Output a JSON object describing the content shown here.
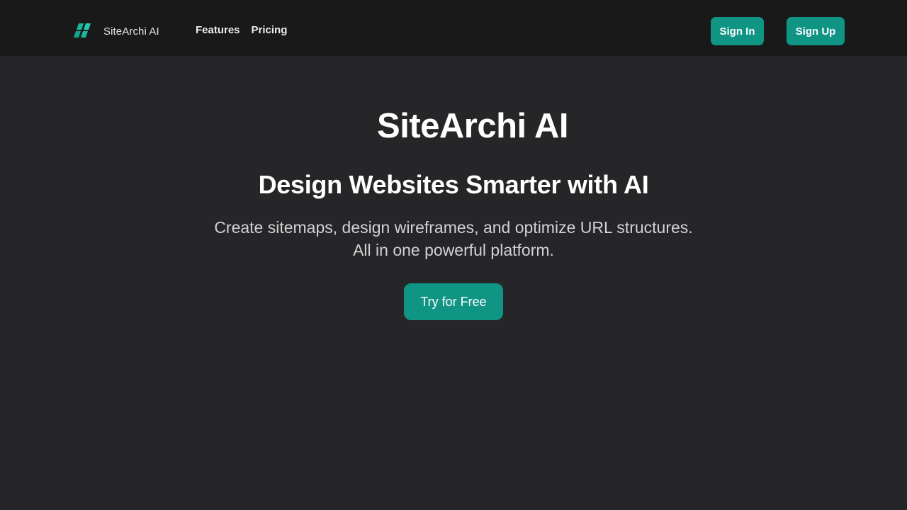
{
  "header": {
    "brand": {
      "name": "SiteArchi AI",
      "icon": "parallelogram-grid-logo-icon",
      "icon_color": "#1fb89f"
    },
    "nav": [
      {
        "label": "Features"
      },
      {
        "label": "Pricing"
      }
    ],
    "signin_label": "Sign In",
    "signup_label": "Sign Up"
  },
  "hero": {
    "title": "SiteArchi AI",
    "subtitle": "Design Websites Smarter with AI",
    "description_line1": "Create sitemaps, design wireframes, and optimize URL structures.",
    "description_line2": "All in one powerful platform.",
    "cta_label": "Try for Free"
  },
  "colors": {
    "background": "#262628",
    "navbar": "#191919",
    "accent": "#109484",
    "text": "#ffffff",
    "muted_text": "#d2d2d4"
  }
}
